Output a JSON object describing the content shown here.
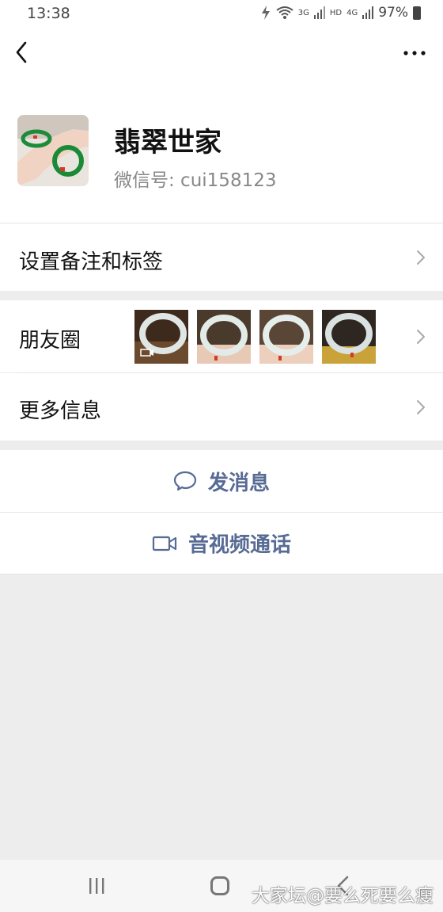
{
  "status_bar": {
    "time": "13:38",
    "net_3g": "3G",
    "hd": "HD",
    "net_4g": "4G",
    "battery": "97%"
  },
  "profile": {
    "name": "翡翠世家",
    "wechat_id": "微信号: cui158123"
  },
  "rows": {
    "remark_tags": "设置备注和标签",
    "moments": "朋友圈",
    "more_info": "更多信息"
  },
  "actions": {
    "send_message": "发消息",
    "video_call": "音视频通话"
  },
  "watermark": "大家坛@要么死要么瘦",
  "colors": {
    "link_blue": "#576b95",
    "background_gray": "#ededed"
  }
}
